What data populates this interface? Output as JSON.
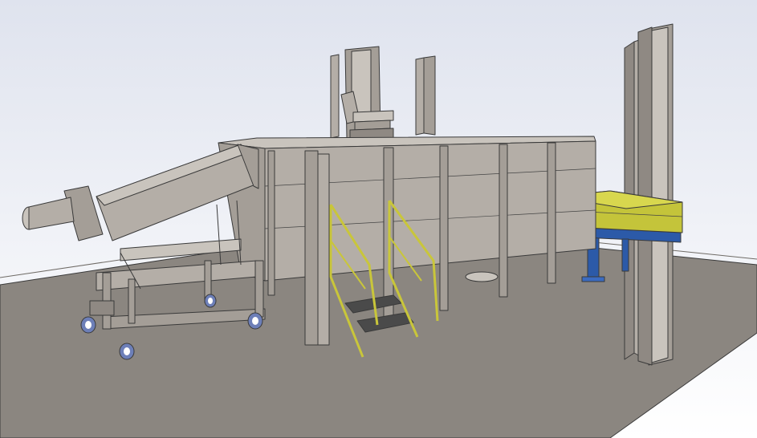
{
  "scene": {
    "description_visible_text": "",
    "colors": {
      "background_top": "#dfe3ee",
      "background_bottom": "#ffffff",
      "floor": "#8b8680",
      "steel": "#b4aea7",
      "steel_dark": "#8f8983",
      "steel_light": "#c9c4bd",
      "stair_rail": "#c9c63a",
      "conveyor_yellow": "#c4c43a",
      "support_blue": "#2c5aa8",
      "caster_blue": "#6d7fb8",
      "outline": "#3a3a3a"
    },
    "components": [
      {
        "id": "floor-slab",
        "icon": "floor-plane"
      },
      {
        "id": "main-tank",
        "icon": "box-tank"
      },
      {
        "id": "inclined-screw-conveyor",
        "icon": "screw-conveyor"
      },
      {
        "id": "mobile-cart-frame",
        "icon": "cart-frame"
      },
      {
        "id": "casters",
        "icon": "caster-wheel",
        "count": 4
      },
      {
        "id": "access-stairs",
        "icon": "stairs"
      },
      {
        "id": "exhaust-stacks",
        "icon": "chimney",
        "count": 2
      },
      {
        "id": "top-valve-assembly",
        "icon": "valve"
      },
      {
        "id": "discharge-conveyor",
        "icon": "belt-conveyor"
      },
      {
        "id": "conveyor-support",
        "icon": "support-stand"
      },
      {
        "id": "structural-column",
        "icon": "i-beam-column"
      }
    ]
  }
}
